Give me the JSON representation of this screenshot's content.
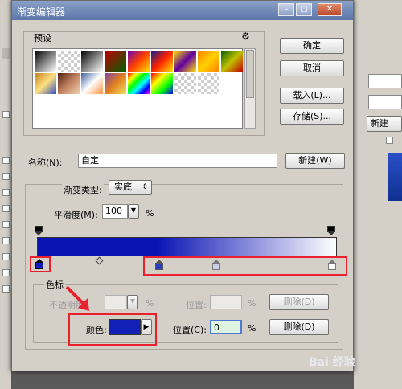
{
  "dialog": {
    "title": "渐变编辑器",
    "controls": {
      "minimize": "–",
      "restore": "□",
      "close": "✕"
    }
  },
  "presets": {
    "label": "预设",
    "menu_icon": "gear-icon",
    "swatches_row1": [
      "linear-gradient(135deg,#000,#fff)",
      "checker",
      "linear-gradient(135deg,#000,#fff)",
      "linear-gradient(135deg,#c00000,#006000)",
      "linear-gradient(135deg,#6b00b0,#ff4000,#ffe000)",
      "linear-gradient(135deg,#102090,#ff2000,#ffe000)",
      "linear-gradient(135deg,#ffe000,#6000a0,#ffe000)",
      "linear-gradient(135deg,#ff8000,#ffd000,#ff8000)",
      "linear-gradient(135deg,#006000,#c0c000,#c00000)"
    ],
    "swatches_row2": [
      "linear-gradient(135deg,#c08020,#ffe080,#3050c0)",
      "linear-gradient(135deg,#502010,#c08060,#f0d0b0)",
      "linear-gradient(135deg,#4060a0,#ffffff,#ff9040)",
      "linear-gradient(135deg,#8040a0,#e08020,#f0e060)",
      "linear-gradient(135deg,#ff0000,#ffff00,#00ff00,#00ffff,#0000ff,#ff00ff)",
      "linear-gradient(135deg,#ff0000,#ffff00,#00ff00,#0000ff)",
      "checker",
      "checker"
    ]
  },
  "buttons": {
    "ok": "确定",
    "cancel": "取消",
    "load": "载入(L)...",
    "save": "存储(S)...",
    "new": "新建(W)"
  },
  "name_field": {
    "label": "名称(N):",
    "value": "自定"
  },
  "gradient_type": {
    "label": "渐变类型:",
    "value": "实底"
  },
  "smoothness": {
    "label": "平滑度(M):",
    "value": "100",
    "unit": "%"
  },
  "gradient_bar": {
    "start_color": "#0a14b4",
    "end_color": "#ffffff"
  },
  "color_stops_group": {
    "label": "色标",
    "opacity_label": "不透明度:",
    "opacity_unit": "%",
    "opacity_location_label": "位置:",
    "opacity_location_unit": "%",
    "opacity_delete": "删除(D)",
    "color_label": "颜色:",
    "color_value": "#1220b8",
    "location_label": "位置(C):",
    "location_value": "0",
    "location_unit": "%",
    "delete_button": "删除(D)"
  },
  "background_app": {
    "right_new_label": "新建"
  },
  "watermark": "Bai 经验"
}
